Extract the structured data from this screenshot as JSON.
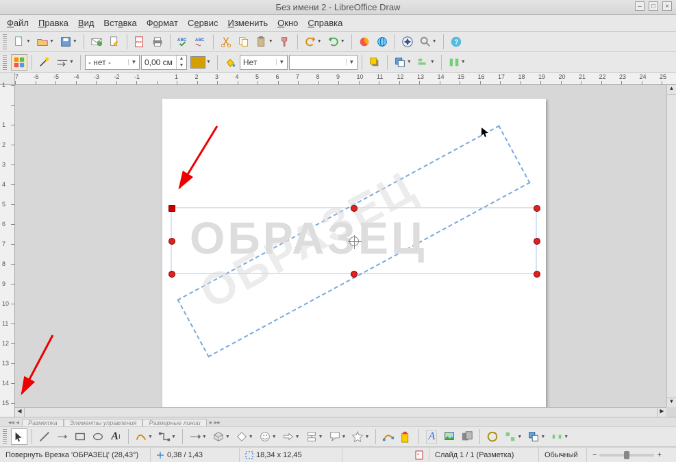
{
  "title": "Без имени 2 - LibreOffice Draw",
  "menu": [
    "Файл",
    "Правка",
    "Вид",
    "Вставка",
    "Формат",
    "Сервис",
    "Изменить",
    "Окно",
    "Справка"
  ],
  "toolbar2": {
    "line_style": "- нет -",
    "line_width": "0,00 см",
    "line_color": "#d4a000",
    "arrow_style": "Нет",
    "fill_color": "#e8a33d"
  },
  "canvas": {
    "watermark_text": "ОБРАЗЕЦ",
    "rotation_deg": -28.43
  },
  "tabs": [
    "Разметка",
    "Элементы управления",
    "Размерные линии"
  ],
  "status": {
    "action": "Повернуть Врезка 'ОБРАЗЕЦ' (28,43°)",
    "pos": "0,38 / 1,43",
    "size": "18,34 x 12,45",
    "slide": "Слайд 1 / 1 (Разметка)",
    "mode": "Обычный"
  },
  "hruler": [
    "-7",
    "-6",
    "-5",
    "-4",
    "-3",
    "-2",
    "-1",
    "",
    "1",
    "2",
    "3",
    "4",
    "5",
    "6",
    "7",
    "8",
    "9",
    "10",
    "11",
    "12",
    "13",
    "14",
    "15",
    "16",
    "17",
    "18",
    "19",
    "20",
    "21",
    "22",
    "23",
    "24",
    "25"
  ],
  "vruler": [
    "1",
    "",
    "1",
    "2",
    "3",
    "4",
    "5",
    "6",
    "7",
    "8",
    "9",
    "10",
    "11",
    "12",
    "13",
    "14",
    "15"
  ]
}
